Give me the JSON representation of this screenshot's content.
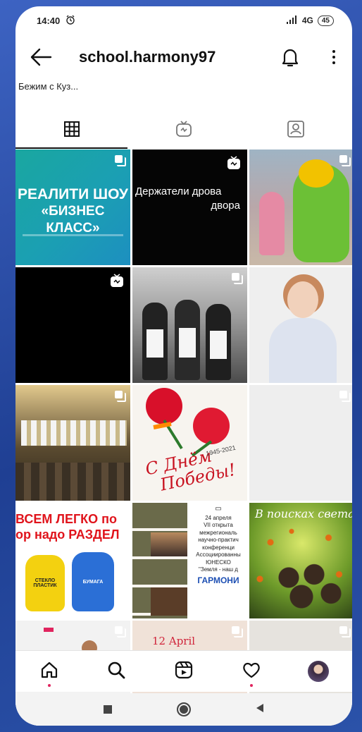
{
  "status": {
    "time": "14:40",
    "network": "4G",
    "battery": "45"
  },
  "header": {
    "username": "school.harmony97"
  },
  "bio_snippet": "Бежим с Куз...",
  "posts": {
    "p1": {
      "line1": "РЕАЛИТИ ШОУ",
      "line2": "«БИЗНЕС КЛАСС»"
    },
    "p2": {
      "line1": "Держатели дрова",
      "line2": "двора"
    },
    "p8": {
      "line1": "С Днём",
      "line2": "Победы!",
      "years": "1945-2021"
    },
    "p10": {
      "line1": "ВСЕМ ЛЕГКО по",
      "line2": "ор надо РАЗДЕЛ",
      "bag1": "СТЕКЛО ПЛАСТИК",
      "bag2": "БУМАГА"
    },
    "p11": {
      "date": "24 апреля",
      "line1": "VII открыта",
      "line2": "межрегиональ",
      "line3": "научно-практич",
      "line4": "конференци",
      "line5": "Ассоциированны",
      "line6": "ЮНЕСКО",
      "line7": "\"Земля - наш д",
      "logo": "ГАРМОНИ"
    },
    "p12": {
      "title": "В поисках света"
    },
    "p14": {
      "title": "12 April"
    }
  },
  "colors": {
    "accent": "#e0245e",
    "page_bg": "#2a4fa8"
  }
}
